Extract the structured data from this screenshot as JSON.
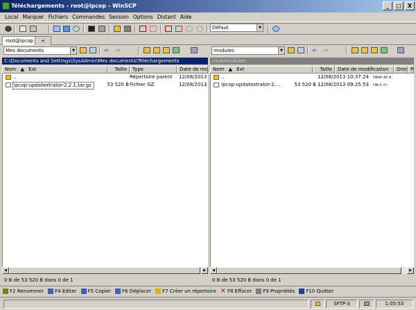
{
  "window": {
    "title": "Téléchargements - root@ipcop - WinSCP",
    "min": "_",
    "max": "□",
    "close": "X"
  },
  "menu": [
    "Local",
    "Marquer",
    "Fichiers",
    "Commandes",
    "Session",
    "Options",
    "Distant",
    "Aide"
  ],
  "toolbar": {
    "transfer_preset": "Défaut"
  },
  "tabs": {
    "session": "root@ipcop",
    "new": "+"
  },
  "left": {
    "location": "Mes documents",
    "path": "C:\\Documents and Settings\\SysAdmin\\Mes documents\\Téléchargements",
    "columns": {
      "name": "Nom",
      "ext": "Ext",
      "size": "Taille",
      "type": "Type",
      "date": "Date de mo"
    },
    "files": [
      {
        "name": "..",
        "size": "",
        "type": "Répertoire parent",
        "date": "12/08/2013"
      },
      {
        "name": "ipcop-updatextrator-2.2.1.tar.gz",
        "size": "53 520 B",
        "type": "Fichier GZ",
        "date": "12/08/2013"
      }
    ],
    "status": "0 B de 53 520 B dans 0 de 1"
  },
  "right": {
    "location": "modules",
    "path": "/root/modules",
    "columns": {
      "name": "Nom",
      "ext": "Ext",
      "size": "Taille",
      "date": "Date de modification",
      "rights": "Droits",
      "owner": "P"
    },
    "files": [
      {
        "name": "..",
        "size": "",
        "date": "12/08/2013 10:37:24",
        "rights": "rwxr-xr-x"
      },
      {
        "name": "ipcop-updatextrator-2....",
        "size": "53 520 B",
        "date": "12/08/2013 09:25:53",
        "rights": "rw-r--r--"
      }
    ],
    "status": "0 B de 53 520 B dans 0 de 1"
  },
  "fkeys": [
    {
      "label": "F2 Renommer",
      "color": "#808000"
    },
    {
      "label": "F4 Editer",
      "color": "#4060c0"
    },
    {
      "label": "F5 Copier",
      "color": "#4060c0"
    },
    {
      "label": "F6 Déplacer",
      "color": "#4060c0"
    },
    {
      "label": "F7 Créer un répertoire",
      "color": "#e0b000"
    },
    {
      "label": "F8 Effacer",
      "color": "#c00000"
    },
    {
      "label": "F9 Propriétés",
      "color": "#808080"
    },
    {
      "label": "F10 Quitter",
      "color": "#2040a0"
    }
  ],
  "statusbar": {
    "protocol": "SFTP-3",
    "elapsed": "1:05:53"
  },
  "colors": {
    "active_path": "#0a246a",
    "inactive_path": "#808080",
    "folder": "#e8c040"
  }
}
